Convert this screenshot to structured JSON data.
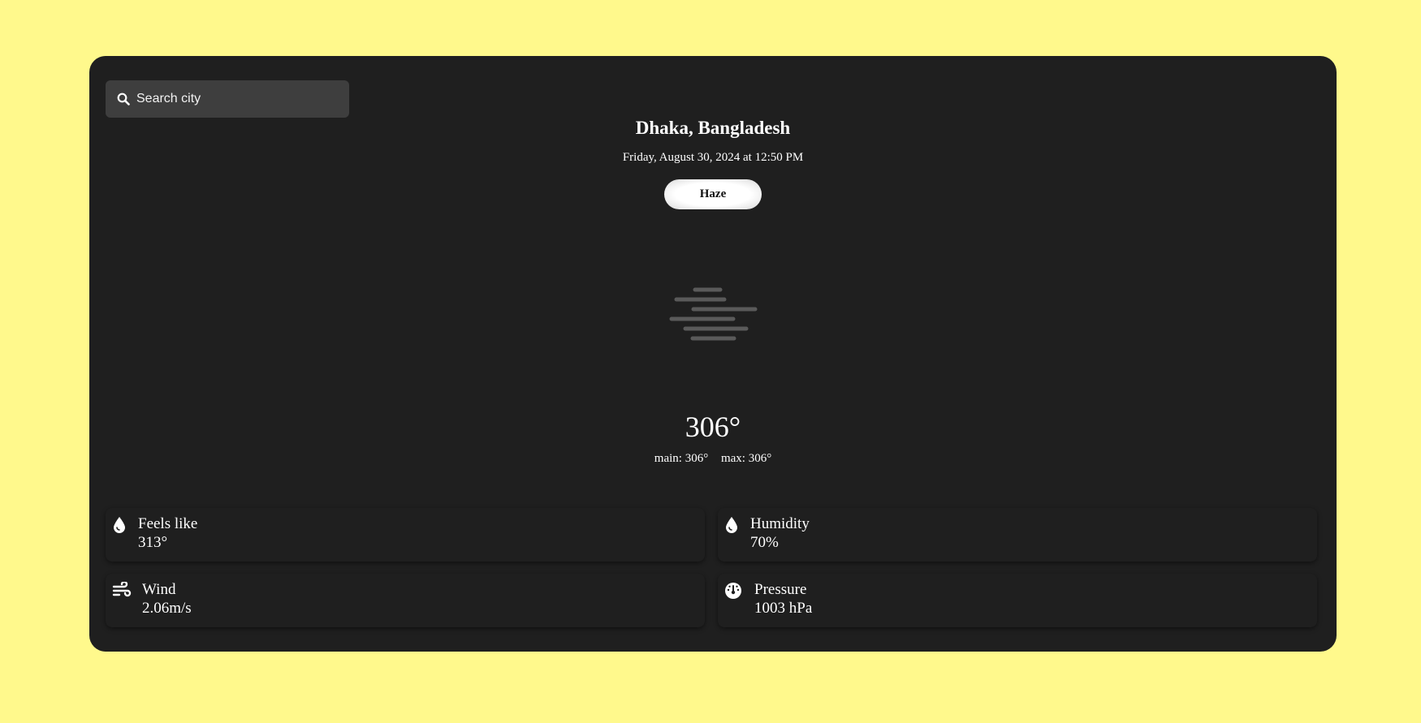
{
  "search": {
    "placeholder": "Search city"
  },
  "location": {
    "city": "Dhaka, Bangladesh",
    "datetime": "Friday, August 30, 2024 at 12:50 PM"
  },
  "condition": {
    "label": "Haze",
    "icon": "haze-icon"
  },
  "temperature": {
    "current": "306°",
    "main": "main: 306°",
    "max": "max: 306°"
  },
  "stats": {
    "feels_like": {
      "label": "Feels like",
      "value": "313°",
      "icon": "water-drop-icon"
    },
    "humidity": {
      "label": "Humidity",
      "value": "70%",
      "icon": "water-drop-icon"
    },
    "wind": {
      "label": "Wind",
      "value": "2.06m/s",
      "icon": "wind-icon"
    },
    "pressure": {
      "label": "Pressure",
      "value": "1003 hPa",
      "icon": "gauge-icon"
    }
  },
  "colors": {
    "background": "#fff98c",
    "card": "#1f1f1f",
    "search_bg": "#3e3e3e",
    "text": "#ffffff"
  }
}
